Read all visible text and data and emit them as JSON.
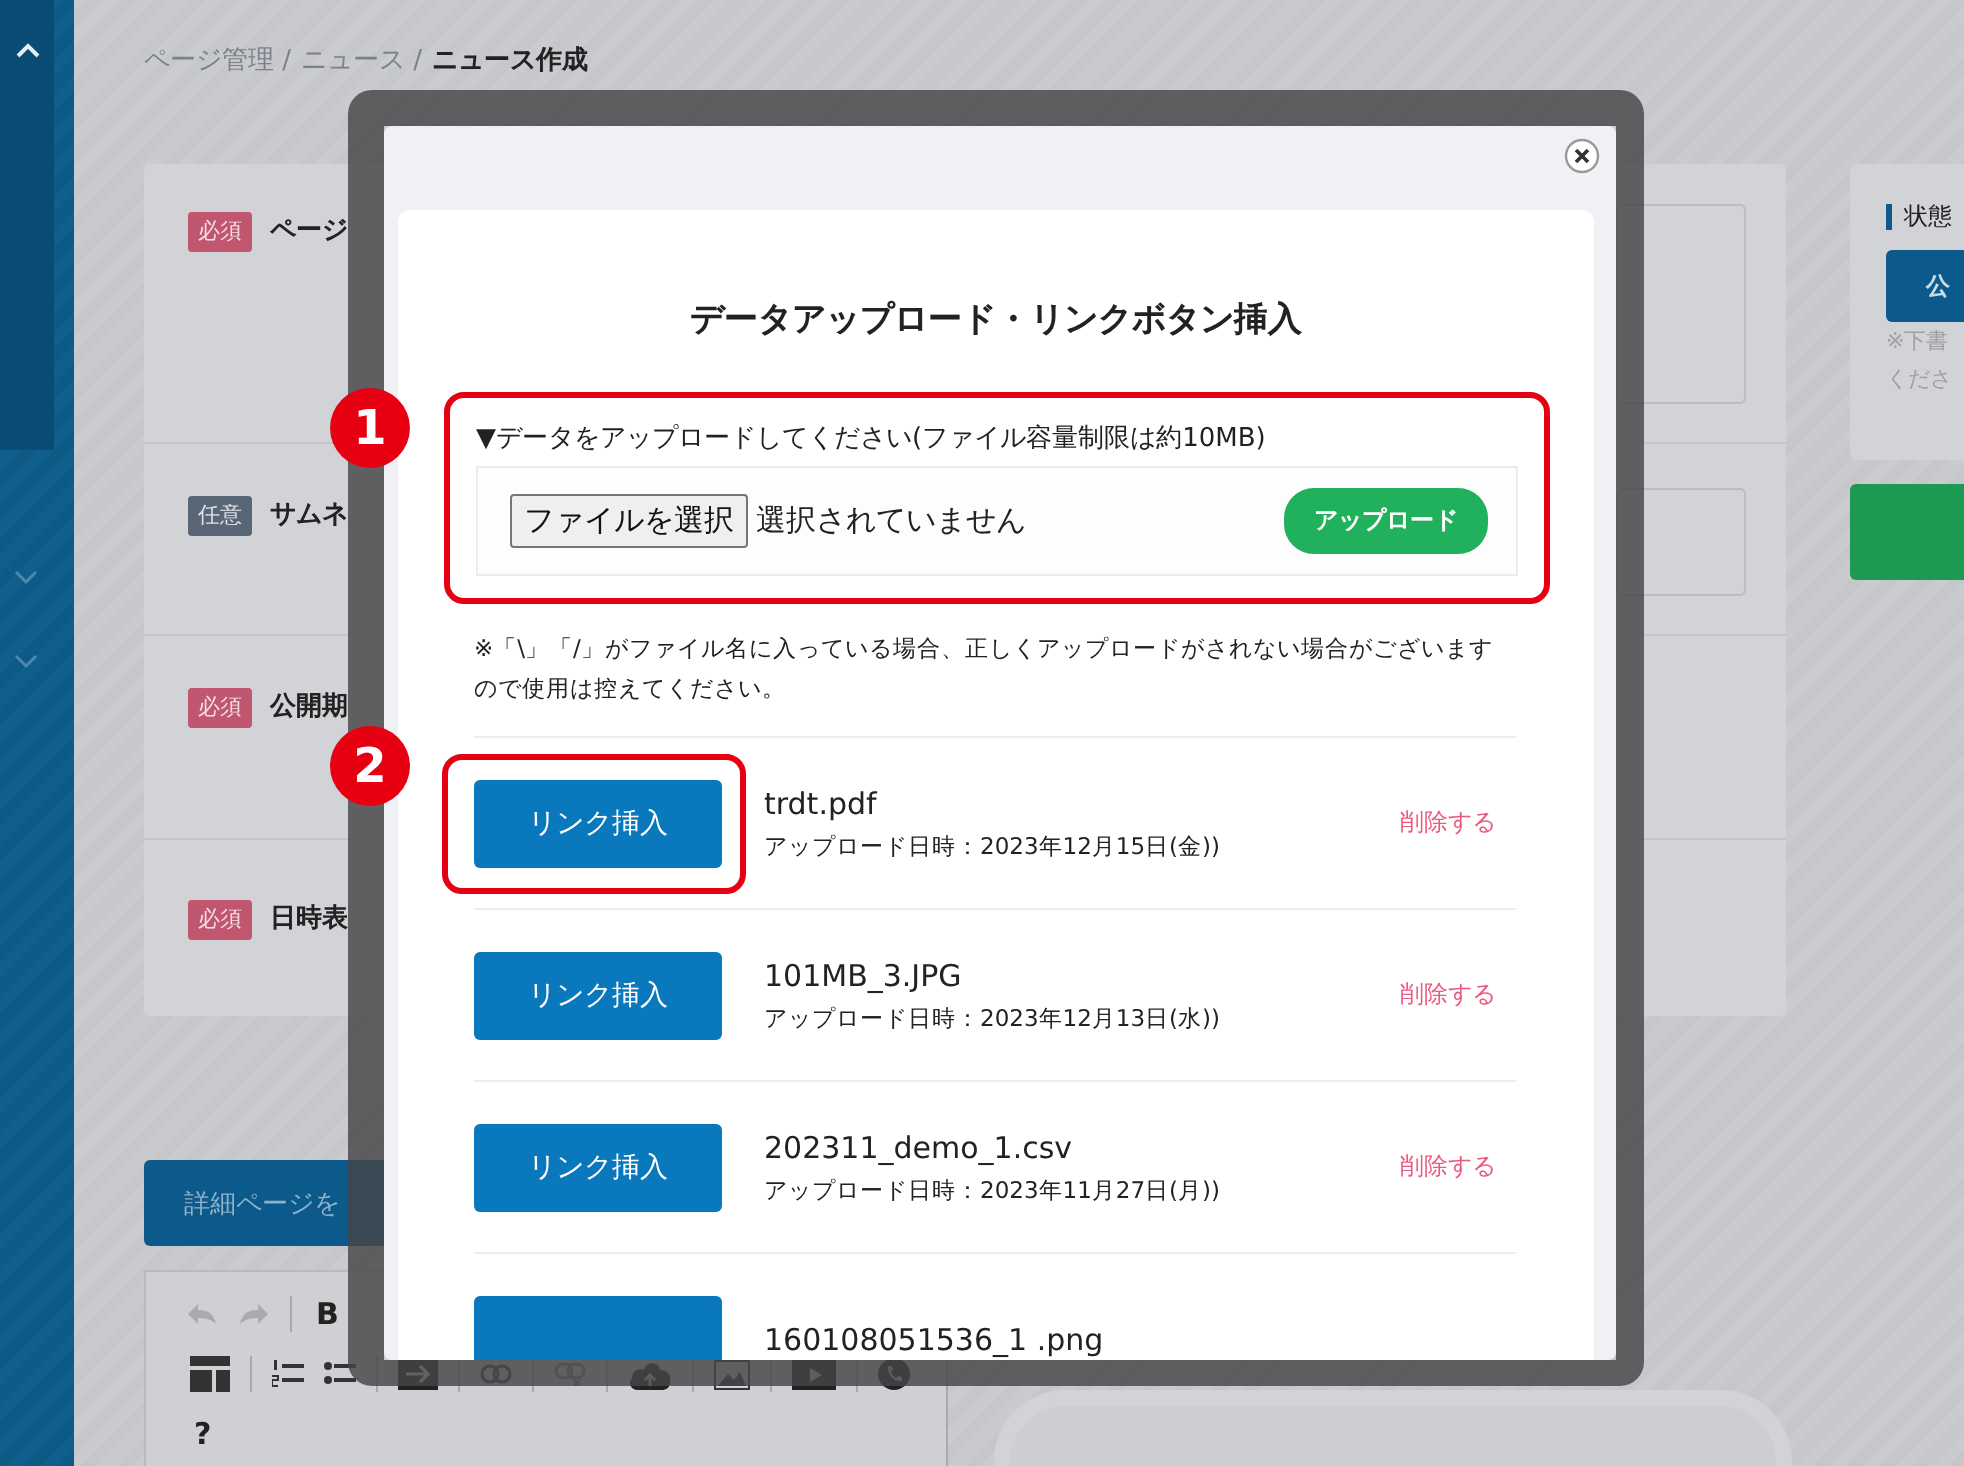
{
  "breadcrumb": [
    {
      "label": "ページ管理 /",
      "current": false
    },
    {
      "label": "ニュース /",
      "current": false
    },
    {
      "label": "ニュース作成",
      "current": true
    }
  ],
  "form": {
    "fields": [
      {
        "badge": "必須",
        "required": true,
        "label": "ページ",
        "kind": "textarea"
      },
      {
        "badge": "任意",
        "required": false,
        "label": "サムネ",
        "kind": "input"
      },
      {
        "badge": "必須",
        "required": true,
        "label": "公開期",
        "kind": "none"
      },
      {
        "badge": "必須",
        "required": true,
        "label": "日時表",
        "kind": "none"
      }
    ]
  },
  "detail_button": "詳細ページを",
  "editor": {
    "bold_button": "B",
    "help_button": "?"
  },
  "status_panel": {
    "title": "状態",
    "button": "公",
    "note": [
      "※下書",
      "くださ"
    ]
  },
  "modal": {
    "title": "データアップロード・リンクボタン挿入",
    "upload": {
      "callout": "1",
      "highlighted": true,
      "label": "▼データをアップロードしてください(ファイル容量制限は約10MB)",
      "file_button": "ファイルを選択",
      "file_status": "選択されていません",
      "upload_button": "アップロード"
    },
    "note": "※「\\」「/」がファイル名に入っている場合、正しくアップロードがされない場合がございますので使用は控えてください。",
    "files": [
      {
        "button": "リンク挿入",
        "name": "trdt.pdf",
        "date": "アップロード日時：2023年12月15日(金))",
        "delete": "削除する",
        "callout": "2",
        "highlighted": true
      },
      {
        "button": "リンク挿入",
        "name": "101MB_3.JPG",
        "date": "アップロード日時：2023年12月13日(水))",
        "delete": "削除する",
        "highlighted": false
      },
      {
        "button": "リンク挿入",
        "name": "202311_demo_1.csv",
        "date": "アップロード日時：2023年11月27日(月))",
        "delete": "削除する",
        "highlighted": false
      },
      {
        "name": "160108051536_1 .png",
        "highlighted": false
      }
    ]
  }
}
